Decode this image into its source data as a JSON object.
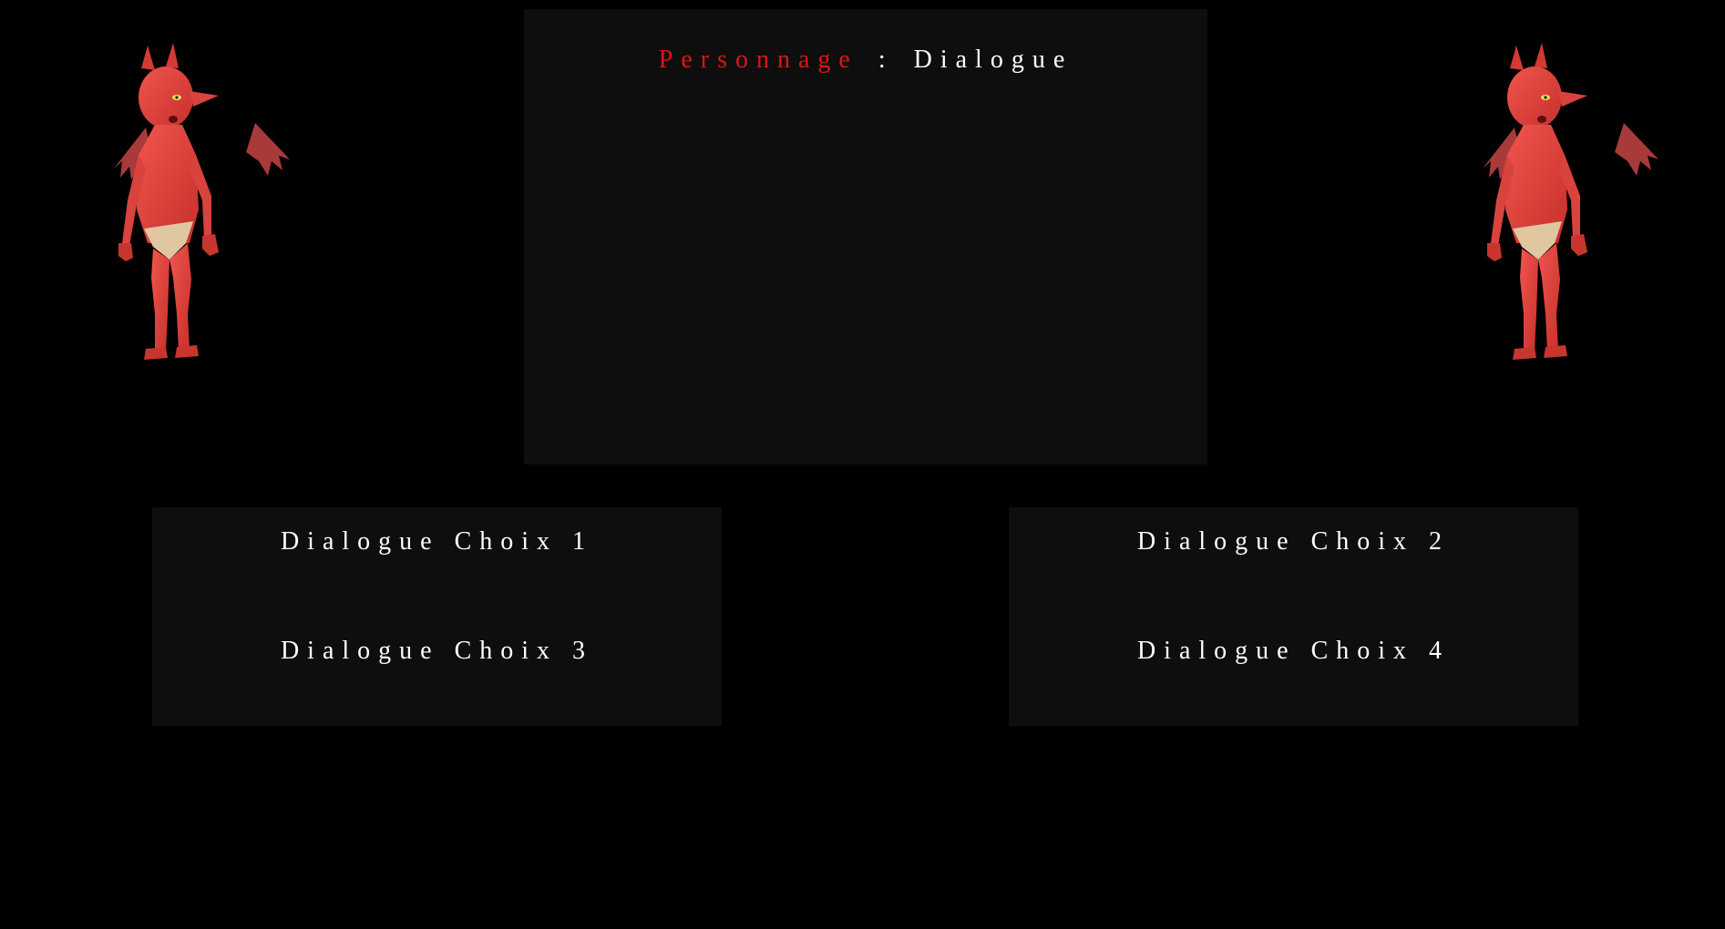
{
  "dialogue": {
    "speaker": "Personnage",
    "separator": ":",
    "text": "Dialogue"
  },
  "choices": [
    {
      "label": "Dialogue Choix 1"
    },
    {
      "label": "Dialogue Choix 2"
    },
    {
      "label": "Dialogue Choix 3"
    },
    {
      "label": "Dialogue Choix 4"
    }
  ],
  "characters": {
    "left": {
      "icon": "red-devil-imp-icon"
    },
    "right": {
      "icon": "red-devil-imp-icon"
    }
  },
  "colors": {
    "background": "#000000",
    "panel": "#0e0e0e",
    "speaker": "#e01414",
    "text": "#ffffff",
    "devil_skin": "#e3423d"
  }
}
